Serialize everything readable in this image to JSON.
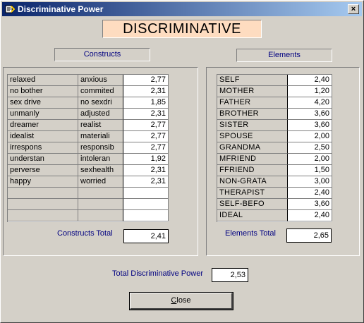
{
  "window": {
    "title": "Discriminative Power",
    "close_glyph": "×"
  },
  "heading": "DISCRIMINATIVE",
  "constructs": {
    "label": "Constructs",
    "rows": [
      {
        "left": "relaxed",
        "right": "anxious",
        "value": "2,77"
      },
      {
        "left": "no bother",
        "right": "commited",
        "value": "2,31"
      },
      {
        "left": "sex drive",
        "right": "no sexdri",
        "value": "1,85"
      },
      {
        "left": "unmanly",
        "right": "adjusted",
        "value": "2,31"
      },
      {
        "left": "dreamer",
        "right": "realist",
        "value": "2,77"
      },
      {
        "left": "idealist",
        "right": "materiali",
        "value": "2,77"
      },
      {
        "left": "irrespons",
        "right": "responsib",
        "value": "2,77"
      },
      {
        "left": "understan",
        "right": "intoleran",
        "value": "1,92"
      },
      {
        "left": "perverse",
        "right": "sexhealth",
        "value": "2,31"
      },
      {
        "left": "happy",
        "right": "worried",
        "value": "2,31"
      },
      {
        "left": "",
        "right": "",
        "value": ""
      },
      {
        "left": "",
        "right": "",
        "value": ""
      },
      {
        "left": "",
        "right": "",
        "value": ""
      }
    ],
    "total_label": "Constructs Total",
    "total_value": "2,41"
  },
  "elements": {
    "label": "Elements",
    "rows": [
      {
        "name": "SELF",
        "value": "2,40"
      },
      {
        "name": "MOTHER",
        "value": "1,20"
      },
      {
        "name": "FATHER",
        "value": "4,20"
      },
      {
        "name": "BROTHER",
        "value": "3,60"
      },
      {
        "name": "SISTER",
        "value": "3,60"
      },
      {
        "name": "SPOUSE",
        "value": "2,00"
      },
      {
        "name": "GRANDMA",
        "value": "2,50"
      },
      {
        "name": "MFRIEND",
        "value": "2,00"
      },
      {
        "name": "FFRIEND",
        "value": "1,50"
      },
      {
        "name": "NON-GRATA",
        "value": "3,00"
      },
      {
        "name": "THERAPIST",
        "value": "2,40"
      },
      {
        "name": "SELF-BEFO",
        "value": "3,60"
      },
      {
        "name": "IDEAL",
        "value": "2,40"
      }
    ],
    "total_label": "Elements Total",
    "total_value": "2,65"
  },
  "overall": {
    "label": "Total Discriminative Power",
    "value": "2,53"
  },
  "buttons": {
    "close_prefix": "C",
    "close_rest": "lose"
  }
}
